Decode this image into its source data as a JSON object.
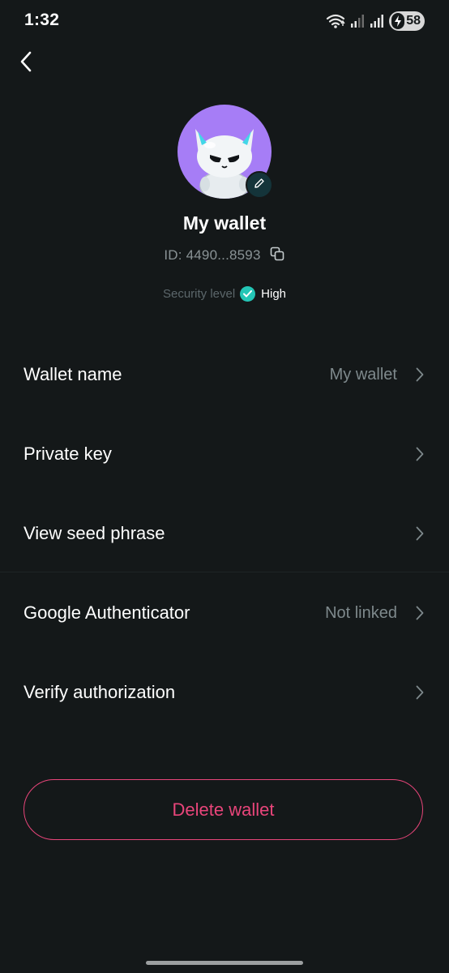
{
  "status_bar": {
    "time": "1:32",
    "battery": "58",
    "icons": [
      "wifi-icon",
      "signal-icon",
      "signal-icon",
      "battery-charging-icon"
    ]
  },
  "header": {
    "back_icon": "chevron-left-icon"
  },
  "profile": {
    "wallet_name": "My wallet",
    "wallet_id": "ID: 4490...8593",
    "security_label": "Security level",
    "security_value": "High",
    "avatar_bg": "#a67df6",
    "security_color": "#24c6b6"
  },
  "settings": [
    {
      "label": "Wallet name",
      "value": "My wallet"
    },
    {
      "label": "Private key",
      "value": ""
    },
    {
      "label": "View seed phrase",
      "value": ""
    },
    {
      "label": "Google Authenticator",
      "value": "Not linked"
    },
    {
      "label": "Verify authorization",
      "value": ""
    }
  ],
  "actions": {
    "delete_label": "Delete wallet",
    "danger_color": "#e8457a"
  }
}
